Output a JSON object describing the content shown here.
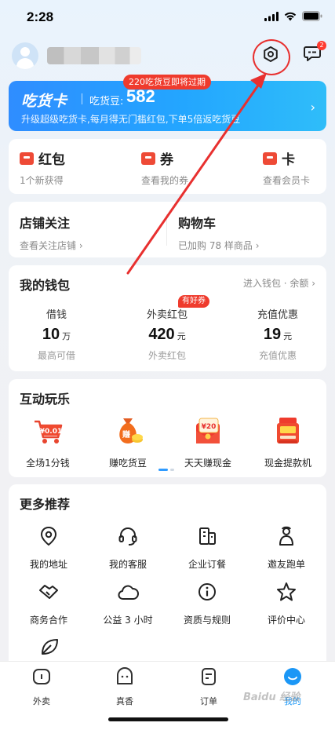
{
  "status_bar": {
    "time": "2:28"
  },
  "colors": {
    "accent": "#1b97f6",
    "red": "#e8302f",
    "card_blue": "#2f8dff"
  },
  "vip": {
    "tag": "220吃货豆即将过期",
    "title": "吃货卡",
    "beans_label": "吃货豆:",
    "beans_value": "582",
    "desc": "升级超级吃货卡,每月得无门槛红包,下单5倍返吃货豆",
    "arrow": "›"
  },
  "benefits": [
    {
      "title": "红包",
      "sub": "1个新获得"
    },
    {
      "title": "券",
      "sub": "查看我的券"
    },
    {
      "title": "卡",
      "sub": "查看会员卡"
    }
  ],
  "shop_cart": {
    "shop_title": "店铺关注",
    "shop_sub": "查看关注店铺 ›",
    "cart_title": "购物车",
    "cart_sub": "已加购 78 样商品 ›"
  },
  "wallet": {
    "title": "我的钱包",
    "link": "进入钱包 · 余额 ›",
    "badge": "有好券",
    "items": [
      {
        "label": "借钱",
        "value": "10",
        "unit": "万",
        "sub": "最高可借"
      },
      {
        "label": "外卖红包",
        "value": "420",
        "unit": "元",
        "sub": "外卖红包"
      },
      {
        "label": "充值优惠",
        "value": "19",
        "unit": "元",
        "sub": "充值优惠"
      }
    ]
  },
  "play": {
    "title": "互动玩乐",
    "items": [
      {
        "label": "全场1分钱",
        "icon_text": "¥0.01"
      },
      {
        "label": "赚吃货豆",
        "icon_text": "赚"
      },
      {
        "label": "天天赚现金",
        "icon_text": "¥20"
      },
      {
        "label": "现金提款机"
      }
    ]
  },
  "more": {
    "title": "更多推荐",
    "items": [
      {
        "label": "我的地址",
        "icon": "location-pin-icon"
      },
      {
        "label": "我的客服",
        "icon": "headset-icon"
      },
      {
        "label": "企业订餐",
        "icon": "building-icon"
      },
      {
        "label": "邀友跑单",
        "icon": "runner-icon"
      },
      {
        "label": "商务合作",
        "icon": "handshake-icon"
      },
      {
        "label": "公益 3 小时",
        "icon": "cloud-icon"
      },
      {
        "label": "资质与规则",
        "icon": "info-icon"
      },
      {
        "label": "评价中心",
        "icon": "star-icon"
      }
    ]
  },
  "tabbar": {
    "items": [
      {
        "label": "外卖"
      },
      {
        "label": "真香"
      },
      {
        "label": "订单"
      },
      {
        "label": "我的",
        "active": true
      }
    ]
  },
  "message_badge": "2",
  "watermark": "Baidu 经验"
}
